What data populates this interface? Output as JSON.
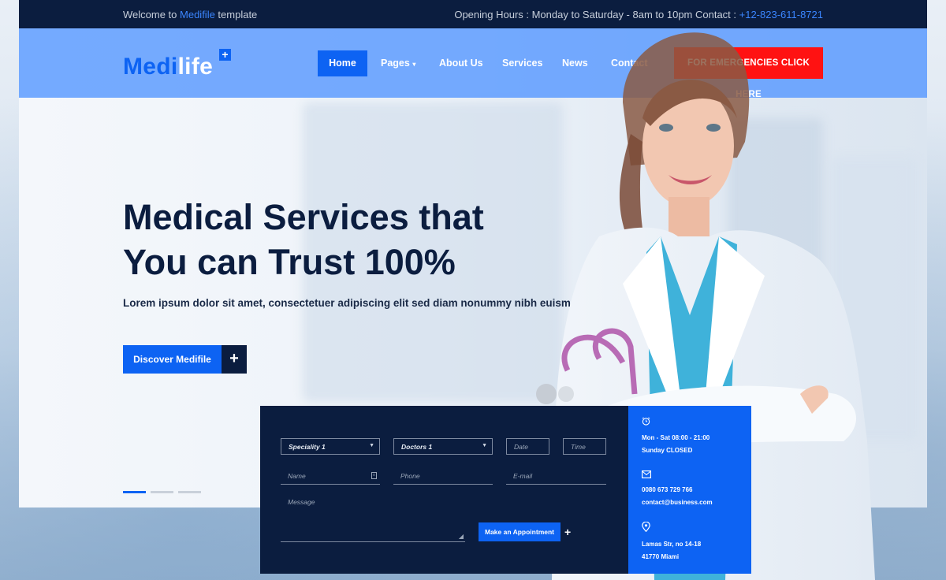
{
  "topbar": {
    "welcome_prefix": "Welcome to ",
    "welcome_brand": "Medifile",
    "welcome_suffix": " template",
    "hours_text": "Opening Hours : Monday to Saturday - 8am to 10pm Contact : ",
    "phone": "+12-823-611-8721"
  },
  "header": {
    "logo_part1": "Medi",
    "logo_part2": "life",
    "logo_plus": "+",
    "nav": [
      {
        "label": "Home"
      },
      {
        "label": "Pages"
      },
      {
        "label": "About Us"
      },
      {
        "label": "Services"
      },
      {
        "label": "News"
      },
      {
        "label": "Contact"
      }
    ],
    "emergency": "FOR EMERGENCIES CLICK HERE"
  },
  "hero": {
    "title_line1": "Medical Services that",
    "title_line2": "You can Trust 100%",
    "subtitle": "Lorem ipsum dolor sit amet, consectetuer adipiscing elit sed diam nonummy nibh euismod.",
    "cta": "Discover Medifile",
    "cta_plus": "+",
    "slides_total": 3,
    "slide_active": 1
  },
  "appointment": {
    "speciality": "Speciality 1",
    "doctor": "Doctors 1",
    "date_placeholder": "Date",
    "time_placeholder": "Time",
    "name_placeholder": "Name",
    "phone_placeholder": "Phone",
    "email_placeholder": "E-mail",
    "message_placeholder": "Message",
    "submit": "Make an Appointment",
    "submit_plus": "+"
  },
  "info": {
    "hours_line1": "Mon - Sat 08:00 - 21:00",
    "hours_line2": "Sunday CLOSED",
    "phone": "0080 673 729 766",
    "email": "contact@business.com",
    "address_line1": "Lamas Str, no 14-18",
    "address_line2": "41770 Miami"
  },
  "colors": {
    "primary": "#0d63f3",
    "dark": "#0b1d3f",
    "emergency": "#ff1212",
    "navbar": "#5898ff"
  }
}
